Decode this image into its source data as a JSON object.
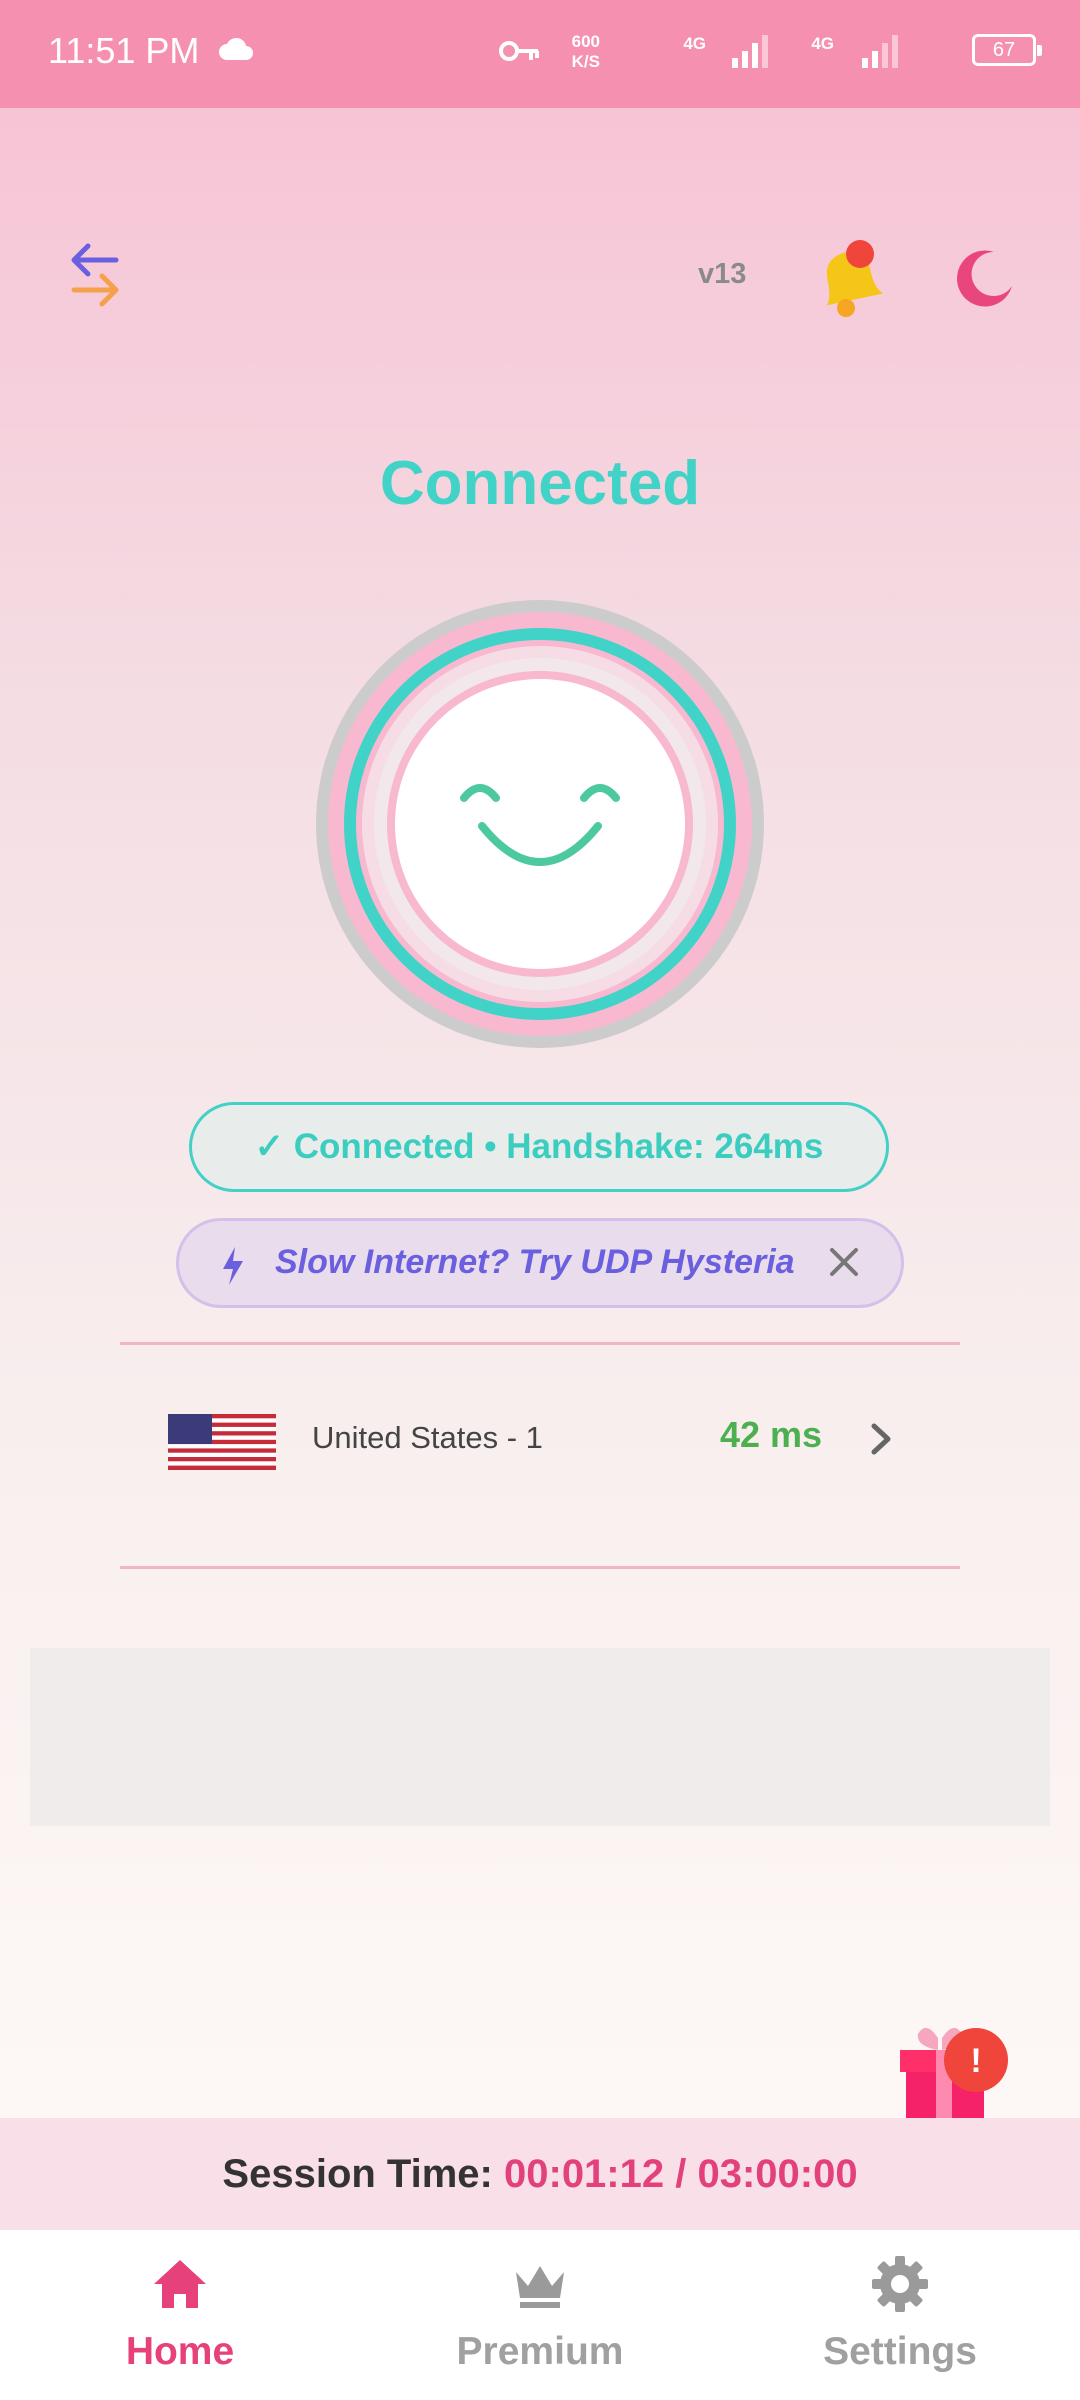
{
  "status_bar": {
    "time": "11:51 PM",
    "speed_value": "600",
    "speed_unit": "K/S",
    "network1": "4G",
    "network2": "4G",
    "battery": "67"
  },
  "header": {
    "version": "v13"
  },
  "connection": {
    "status": "Connected",
    "handshake_text": "✓ Connected • Handshake: 264ms",
    "promo_text": "Slow Internet? Try UDP Hysteria"
  },
  "server": {
    "name": "United States - 1",
    "ping": "42 ms"
  },
  "session": {
    "label": "Session Time:",
    "value": "00:01:12 / 03:00:00"
  },
  "nav": {
    "home": "Home",
    "premium": "Premium",
    "settings": "Settings"
  },
  "gift_badge": "!",
  "colors": {
    "accent_teal": "#42d3c8",
    "accent_pink": "#e6417b",
    "status_bar": "#f590b1",
    "ping_green": "#4caf50",
    "promo_purple": "#6a5fde"
  }
}
